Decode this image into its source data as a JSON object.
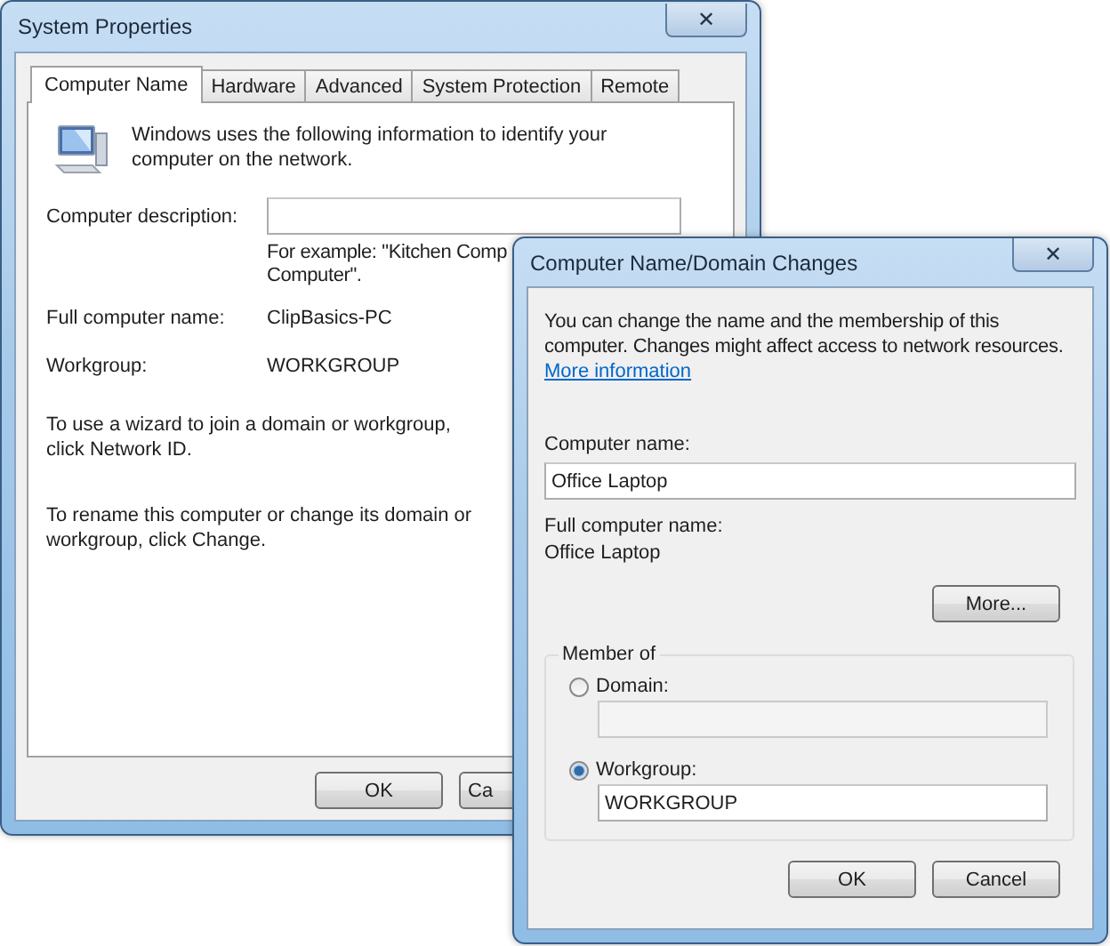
{
  "system_properties": {
    "title": "System Properties",
    "close": "✕",
    "tabs": [
      {
        "label": "Computer Name",
        "selected": true
      },
      {
        "label": "Hardware",
        "selected": false
      },
      {
        "label": "Advanced",
        "selected": false
      },
      {
        "label": "System Protection",
        "selected": false
      },
      {
        "label": "Remote",
        "selected": false
      }
    ],
    "intro": "Windows uses the following information to identify your computer on the network.",
    "description_label": "Computer description:",
    "description_hint": [
      "For example: \"Kitchen Comp",
      "Computer\"."
    ],
    "full_name_label": "Full computer name:",
    "full_name": "ClipBasics-PC",
    "workgroup_label": "Workgroup:",
    "workgroup": "WORKGROUP",
    "network_id_text": "To use a wizard to join a domain or workgroup, click Network ID.",
    "change_text": "To rename this computer or change its domain or workgroup, click Change.",
    "buttons": [
      "OK",
      "Ca"
    ]
  },
  "domain_changes": {
    "title": "Computer Name/Domain Changes",
    "close": "✕",
    "intro": "You can change the name and the membership of this computer. Changes might affect access to network resources.",
    "link": "More information",
    "computer_name_label": "Computer name:",
    "computer_name": "Office Laptop",
    "full_name_label": "Full computer name:",
    "full_name": "Office Laptop",
    "more_button": "More...",
    "member_of": {
      "label": "Member of",
      "options": [
        {
          "label": "Domain:",
          "selected": false
        },
        {
          "label": "Workgroup:",
          "selected": true,
          "value": "WORKGROUP"
        }
      ]
    },
    "buttons": [
      "OK",
      "Cancel"
    ]
  }
}
